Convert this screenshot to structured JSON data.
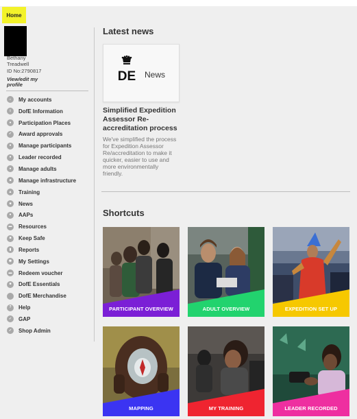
{
  "breadcrumb": {
    "home": "Home"
  },
  "user": {
    "name": "Bethany Treadwell",
    "id": "ID No:2790817",
    "profile_link": "View/edit my profile"
  },
  "sidebar": {
    "items": [
      {
        "label": "My accounts",
        "icon": "home-icon"
      },
      {
        "label": "DofE Information",
        "icon": "info-icon"
      },
      {
        "label": "Participation Places",
        "icon": "person-icon"
      },
      {
        "label": "Award approvals",
        "icon": "award-icon"
      },
      {
        "label": "Manage participants",
        "icon": "participants-icon"
      },
      {
        "label": "Leader recorded",
        "icon": "leader-icon"
      },
      {
        "label": "Manage adults",
        "icon": "adults-icon"
      },
      {
        "label": "Manage infrastructure",
        "icon": "infrastructure-icon"
      },
      {
        "label": "Training",
        "icon": "training-icon"
      },
      {
        "label": "News",
        "icon": "news-icon"
      },
      {
        "label": "AAPs",
        "icon": "aaps-icon"
      },
      {
        "label": "Resources",
        "icon": "resources-icon"
      },
      {
        "label": "Keep Safe",
        "icon": "lock-icon"
      },
      {
        "label": "Reports",
        "icon": "reports-icon"
      },
      {
        "label": "My Settings",
        "icon": "settings-icon"
      },
      {
        "label": "Redeem voucher",
        "icon": "voucher-icon"
      },
      {
        "label": "DofE Essentials",
        "icon": "essentials-icon"
      },
      {
        "label": "DofE Merchandise",
        "icon": "merchandise-icon"
      },
      {
        "label": "Help",
        "icon": "help-icon"
      },
      {
        "label": "GAP",
        "icon": "gap-icon"
      },
      {
        "label": "Shop Admin",
        "icon": "shop-icon"
      }
    ]
  },
  "latest_news": {
    "heading": "Latest news",
    "card_label": "News",
    "logo_text": "DE",
    "article_title": "Simplified Expedition Assessor Re-accreditation process",
    "article_text": "We've simplified the process for Expedition Assessor Re/accreditation to make it quicker, easier to use and more environmentally friendly."
  },
  "shortcuts": {
    "heading": "Shortcuts",
    "tiles": [
      {
        "label": "PARTICIPANT OVERVIEW",
        "color": "#7b1fd6"
      },
      {
        "label": "ADULT OVERVIEW",
        "color": "#22d36e"
      },
      {
        "label": "EXPEDITION SET UP",
        "color": "#f6c800"
      },
      {
        "label": "MAPPING",
        "color": "#3b34f2"
      },
      {
        "label": "MY TRAINING",
        "color": "#ef2430"
      },
      {
        "label": "LEADER RECORDED",
        "color": "#ee2fa0"
      }
    ]
  },
  "colors": {
    "highlight": "#f3f22a",
    "sidebar_icon": "#a9a9a9",
    "background": "#efefef"
  }
}
